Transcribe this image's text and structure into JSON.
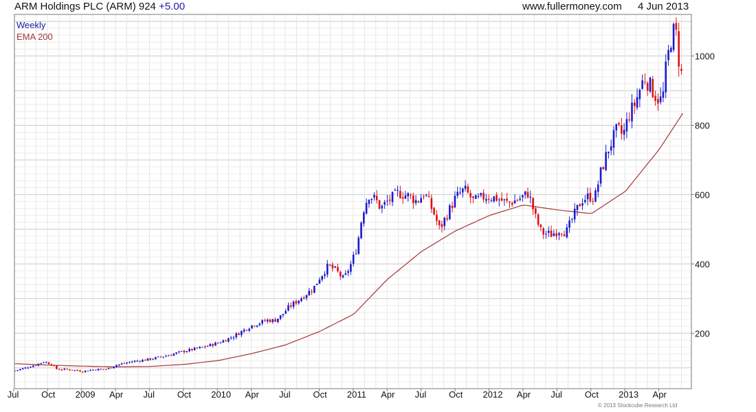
{
  "header": {
    "title": "ARM Holdings PLC (ARM) 924",
    "change": "+5.00",
    "site": "www.fullermoney.com",
    "date": "4 Jun 2013"
  },
  "legend": {
    "series1": "Weekly",
    "series2": "EMA 200"
  },
  "copyright": "© 2013 Stockcube Research Ltd",
  "colors": {
    "up": "#1a1ad0",
    "down": "#e01010",
    "ema": "#a83232",
    "grid": "#d8d8d8",
    "frame": "#777777",
    "text": "#111111"
  },
  "chart_data": {
    "type": "candlestick",
    "title": "ARM Holdings PLC (ARM) 924 +5.00",
    "frequency": "Weekly",
    "ylim": [
      40,
      1120
    ],
    "yticks": [
      200,
      400,
      600,
      800,
      1000
    ],
    "x_labels": [
      "Jul",
      "Oct",
      "2009",
      "Apr",
      "Jul",
      "Oct",
      "2010",
      "Apr",
      "Jul",
      "Oct",
      "2011",
      "Apr",
      "Jul",
      "Oct",
      "2012",
      "Apr",
      "Jul",
      "Oct",
      "2013",
      "Apr"
    ],
    "close_anchors": [
      [
        "2008-07-04",
        92
      ],
      [
        "2008-08-01",
        100
      ],
      [
        "2008-09-01",
        110
      ],
      [
        "2008-09-20",
        118
      ],
      [
        "2008-10-10",
        110
      ],
      [
        "2008-10-25",
        96
      ],
      [
        "2008-12-01",
        95
      ],
      [
        "2009-01-01",
        90
      ],
      [
        "2009-02-01",
        95
      ],
      [
        "2009-03-10",
        97
      ],
      [
        "2009-04-01",
        108
      ],
      [
        "2009-05-15",
        118
      ],
      [
        "2009-07-01",
        125
      ],
      [
        "2009-08-15",
        135
      ],
      [
        "2009-10-01",
        148
      ],
      [
        "2009-11-15",
        158
      ],
      [
        "2010-01-01",
        172
      ],
      [
        "2010-02-10",
        190
      ],
      [
        "2010-04-01",
        222
      ],
      [
        "2010-05-15",
        238
      ],
      [
        "2010-06-01",
        236
      ],
      [
        "2010-06-20",
        250
      ],
      [
        "2010-07-10",
        275
      ],
      [
        "2010-08-10",
        300
      ],
      [
        "2010-09-15",
        330
      ],
      [
        "2010-10-01",
        360
      ],
      [
        "2010-10-25",
        395
      ],
      [
        "2010-11-15",
        380
      ],
      [
        "2010-12-05",
        355
      ],
      [
        "2010-12-25",
        400
      ],
      [
        "2011-01-10",
        450
      ],
      [
        "2011-01-25",
        550
      ],
      [
        "2011-02-10",
        600
      ],
      [
        "2011-03-01",
        585
      ],
      [
        "2011-03-15",
        560
      ],
      [
        "2011-04-01",
        580
      ],
      [
        "2011-05-01",
        605
      ],
      [
        "2011-06-01",
        595
      ],
      [
        "2011-06-20",
        580
      ],
      [
        "2011-07-10",
        605
      ],
      [
        "2011-08-05",
        545
      ],
      [
        "2011-08-20",
        500
      ],
      [
        "2011-09-10",
        545
      ],
      [
        "2011-10-01",
        590
      ],
      [
        "2011-10-25",
        615
      ],
      [
        "2011-11-20",
        580
      ],
      [
        "2011-12-20",
        595
      ],
      [
        "2012-01-20",
        590
      ],
      [
        "2012-02-20",
        575
      ],
      [
        "2012-03-25",
        590
      ],
      [
        "2012-04-15",
        605
      ],
      [
        "2012-05-05",
        530
      ],
      [
        "2012-05-20",
        490
      ],
      [
        "2012-06-15",
        485
      ],
      [
        "2012-07-10",
        500
      ],
      [
        "2012-07-25",
        490
      ],
      [
        "2012-08-15",
        540
      ],
      [
        "2012-09-05",
        585
      ],
      [
        "2012-09-25",
        595
      ],
      [
        "2012-10-10",
        590
      ],
      [
        "2012-10-25",
        660
      ],
      [
        "2012-11-15",
        730
      ],
      [
        "2012-12-10",
        790
      ],
      [
        "2012-12-25",
        770
      ],
      [
        "2013-01-10",
        830
      ],
      [
        "2013-01-25",
        860
      ],
      [
        "2013-02-20",
        940
      ],
      [
        "2013-03-10",
        910
      ],
      [
        "2013-03-25",
        880
      ],
      [
        "2013-04-10",
        870
      ],
      [
        "2013-04-20",
        970
      ],
      [
        "2013-05-05",
        1060
      ],
      [
        "2013-05-15",
        1080
      ],
      [
        "2013-05-24",
        990
      ],
      [
        "2013-06-04",
        924
      ]
    ],
    "ema200_anchors": [
      [
        "2008-07-04",
        112
      ],
      [
        "2008-10-01",
        108
      ],
      [
        "2009-01-01",
        105
      ],
      [
        "2009-04-01",
        103
      ],
      [
        "2009-07-01",
        104
      ],
      [
        "2009-10-01",
        110
      ],
      [
        "2010-01-01",
        121
      ],
      [
        "2010-04-01",
        141
      ],
      [
        "2010-07-01",
        166
      ],
      [
        "2010-10-01",
        205
      ],
      [
        "2011-01-01",
        255
      ],
      [
        "2011-04-01",
        355
      ],
      [
        "2011-07-01",
        435
      ],
      [
        "2011-10-01",
        495
      ],
      [
        "2012-01-01",
        540
      ],
      [
        "2012-04-01",
        570
      ],
      [
        "2012-07-01",
        556
      ],
      [
        "2012-10-01",
        545
      ],
      [
        "2013-01-01",
        610
      ],
      [
        "2013-04-01",
        730
      ],
      [
        "2013-06-04",
        835
      ]
    ],
    "last_close": 924,
    "change": 5.0,
    "grid": true
  }
}
